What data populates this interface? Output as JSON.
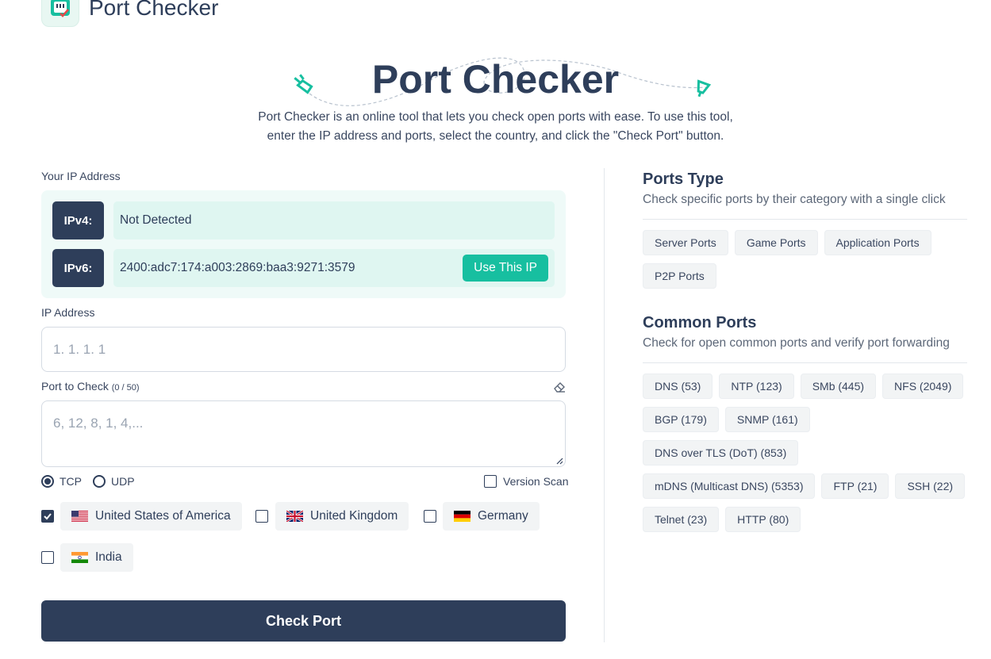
{
  "brand": {
    "name": "Port Checker"
  },
  "hero": {
    "title": "Port Checker",
    "description": "Port Checker is an online tool that lets you check open ports with ease. To use this tool, enter the IP address and ports, select the country, and click the \"Check Port\" button."
  },
  "your_ip": {
    "label": "Your IP Address",
    "ipv4_tag": "IPv4:",
    "ipv4_value": "Not Detected",
    "ipv6_tag": "IPv6:",
    "ipv6_value": "2400:adc7:174:a003:2869:baa3:9271:3579",
    "use_button": "Use This IP"
  },
  "ip_field": {
    "label": "IP Address",
    "placeholder": "1. 1. 1. 1"
  },
  "port_field": {
    "label": "Port to Check",
    "count": "(0 / 50)",
    "placeholder": "6, 12, 8, 1, 4,..."
  },
  "protocol": {
    "tcp": "TCP",
    "udp": "UDP",
    "selected": "TCP"
  },
  "version_scan": "Version Scan",
  "countries": [
    {
      "name": "United States of America",
      "checked": true
    },
    {
      "name": "United Kingdom",
      "checked": false
    },
    {
      "name": "Germany",
      "checked": false
    },
    {
      "name": "India",
      "checked": false
    }
  ],
  "check_button": "Check Port",
  "ports_type": {
    "title": "Ports Type",
    "description": "Check specific ports by their category with a single click",
    "chips": [
      "Server Ports",
      "Game Ports",
      "Application Ports",
      "P2P Ports"
    ]
  },
  "common_ports": {
    "title": "Common Ports",
    "description": "Check for open common ports and verify port forwarding",
    "chips": [
      "DNS (53)",
      "NTP (123)",
      "SMb (445)",
      "NFS (2049)",
      "BGP (179)",
      "SNMP (161)",
      "DNS over TLS (DoT) (853)",
      "mDNS (Multicast DNS) (5353)",
      "FTP (21)",
      "SSH (22)",
      "Telnet (23)",
      "HTTP (80)"
    ]
  },
  "colors": {
    "primary": "#2e3e5a",
    "accent": "#17bfa0",
    "ip_box_bg": "#effaf8"
  }
}
